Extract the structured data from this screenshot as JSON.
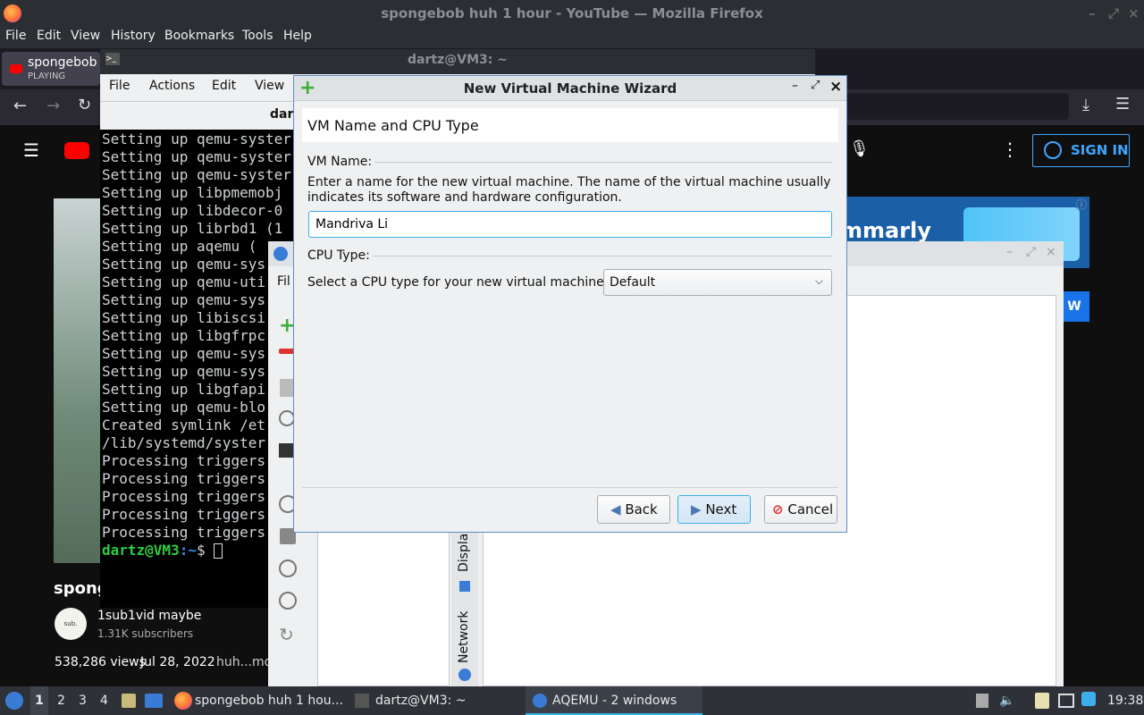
{
  "firefox": {
    "title": "spongebob huh 1 hour - YouTube — Mozilla Firefox",
    "menu": [
      "File",
      "Edit",
      "View",
      "History",
      "Bookmarks",
      "Tools",
      "Help"
    ],
    "tab": {
      "title": "spongebob",
      "status": "PLAYING"
    }
  },
  "youtube": {
    "sign_in": "SIGN IN",
    "ad_text": "mmarly",
    "ad_button": "W",
    "video_title": "spong",
    "channel": {
      "name": "1sub1vid maybe",
      "subscribers": "1.31K subscribers",
      "avatar_text": "sub."
    },
    "views": "538,286 views",
    "date": "Jul 28, 2022",
    "description": "huh...mo"
  },
  "terminal": {
    "title": "dartz@VM3: ~",
    "menu": [
      "File",
      "Actions",
      "Edit",
      "View"
    ],
    "tab_label": "dar",
    "lines": [
      "Setting up qemu-syster",
      "Setting up qemu-syster",
      "Setting up qemu-syster",
      "Setting up libpmemobj",
      "Setting up libdecor-0",
      "Setting up librbd1 (1",
      "Setting up aqemu (",
      "Setting up qemu-sys",
      "Setting up qemu-uti",
      "Setting up qemu-sys",
      "Setting up libiscsi",
      "Setting up libgfrpc",
      "Setting up qemu-sys",
      "Setting up qemu-sys",
      "Setting up libgfapi",
      "Setting up qemu-blo",
      "Created symlink /et",
      "/lib/systemd/syster",
      "Processing triggers",
      "Processing triggers",
      "Processing triggers",
      "Processing triggers",
      "Processing triggers"
    ],
    "prompt_user": "dartz@VM3",
    "prompt_path": ":~",
    "prompt_sym": "$ "
  },
  "aqemu": {
    "menu_partial": "Fil",
    "side_tabs": [
      "Network",
      "Displa"
    ]
  },
  "wizard": {
    "title": "New Virtual Machine Wizard",
    "header": "VM Name and CPU Type",
    "vm_name_section": "VM Name:",
    "vm_name_desc": "Enter a name for the new virtual machine. The name of the virtual machine usually indicates its software and hardware configuration.",
    "vm_name_value": "Mandriva Li",
    "cpu_section": "CPU Type:",
    "cpu_label": "Select a CPU type for your new virtual machine:",
    "cpu_value": "Default",
    "back": "Back",
    "next": "Next",
    "cancel": "Cancel"
  },
  "taskbar": {
    "desktops": [
      "1",
      "2",
      "3",
      "4"
    ],
    "tasks": [
      "spongebob huh 1 hou...",
      "dartz@VM3: ~",
      "AQEMU - 2 windows"
    ],
    "clock": "19:38"
  },
  "colors": {
    "accent": "#3daee9",
    "terminal_green": "#2ecc40",
    "yt_red": "#ff0000"
  }
}
